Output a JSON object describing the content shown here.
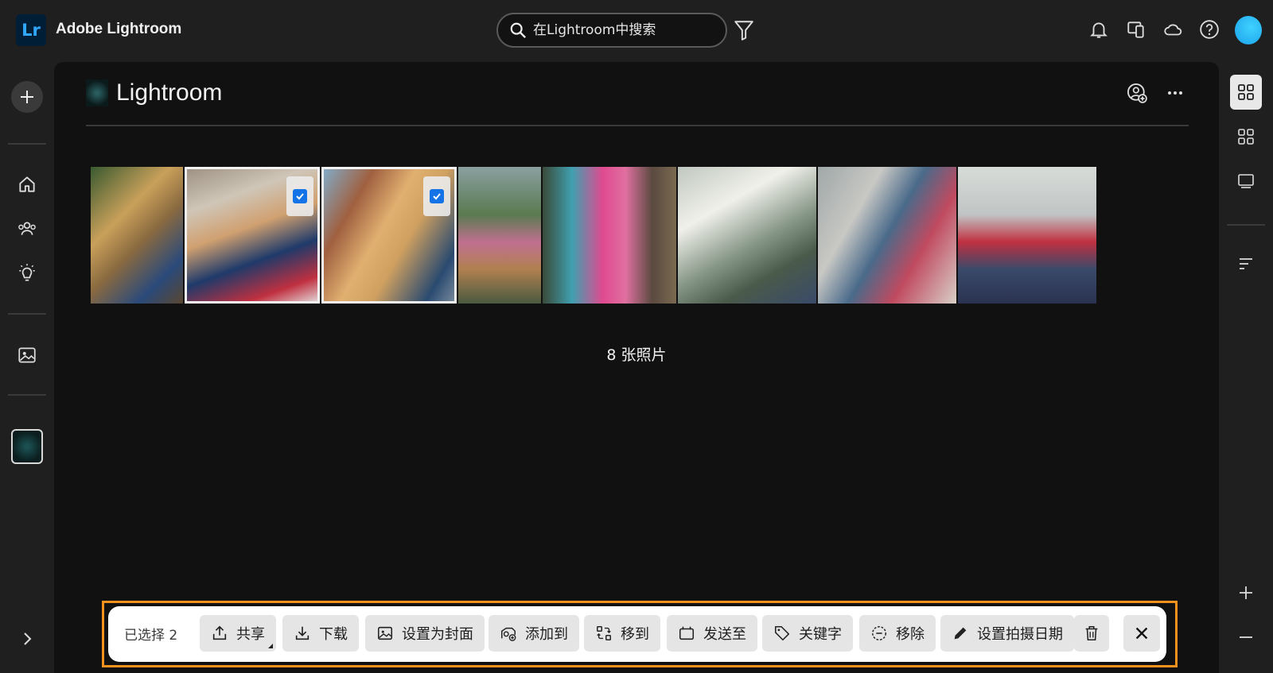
{
  "app": {
    "logo_text": "Lr",
    "title": "Adobe Lightroom"
  },
  "search": {
    "placeholder": "在Lightroom中搜索"
  },
  "header": {
    "title": "Lightroom"
  },
  "photos": {
    "count_label": "8 张照片",
    "items": [
      {
        "id": 1,
        "selected": false
      },
      {
        "id": 2,
        "selected": true
      },
      {
        "id": 3,
        "selected": true
      },
      {
        "id": 4,
        "selected": false
      },
      {
        "id": 5,
        "selected": false
      },
      {
        "id": 6,
        "selected": false
      },
      {
        "id": 7,
        "selected": false
      },
      {
        "id": 8,
        "selected": false
      }
    ]
  },
  "actionbar": {
    "selected_label": "已选择 2",
    "share": "共享",
    "download": "下载",
    "set_cover": "设置为封面",
    "add_to": "添加到",
    "move_to": "移到",
    "send_to": "发送至",
    "keywords": "关键字",
    "remove": "移除",
    "set_date": "设置拍摄日期"
  },
  "colors": {
    "accent_blue": "#1473e6",
    "highlight_orange": "#f5911e",
    "logo_bg": "#001e36",
    "logo_fg": "#31a8ff"
  }
}
